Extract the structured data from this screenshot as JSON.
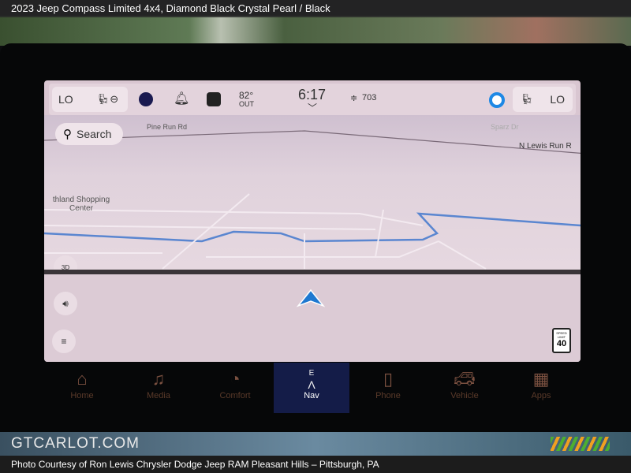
{
  "photo_title": "2023 Jeep Compass Limited 4x4,  Diamond Black Crystal Pearl / Black",
  "status_bar": {
    "left_temp": "LO",
    "right_temp": "LO",
    "outside_temp": "82°",
    "outside_label": "OUT",
    "time": "6:17",
    "altitude": "703"
  },
  "map": {
    "search_label": "Search",
    "roads": [
      "Pine Run Rd",
      "N Lewis Run R",
      "Sparz Dr"
    ],
    "poi": "thland Shopping Center",
    "view_mode": "3D",
    "speed_limit_label": "SPEED LIMIT",
    "speed_limit": "40"
  },
  "nav_bar": {
    "items": [
      {
        "label": "Home",
        "icon": "home-icon"
      },
      {
        "label": "Media",
        "icon": "music-note-icon"
      },
      {
        "label": "Comfort",
        "icon": "seat-icon"
      },
      {
        "label": "Nav",
        "icon": "compass-arrow-icon",
        "compass": "E"
      },
      {
        "label": "Phone",
        "icon": "phone-icon"
      },
      {
        "label": "Vehicle",
        "icon": "car-icon"
      },
      {
        "label": "Apps",
        "icon": "grid-icon"
      }
    ],
    "active": "Nav"
  },
  "watermark": "GTCARLOT.COM",
  "caption": "Photo Courtesy of Ron Lewis Chrysler Dodge Jeep RAM Pleasant Hills – Pittsburgh, PA",
  "colors": {
    "screen": "#d9c6d1",
    "route": "#5a86d0",
    "nav_active": "#141c48",
    "arrow": "#1e78d0"
  }
}
